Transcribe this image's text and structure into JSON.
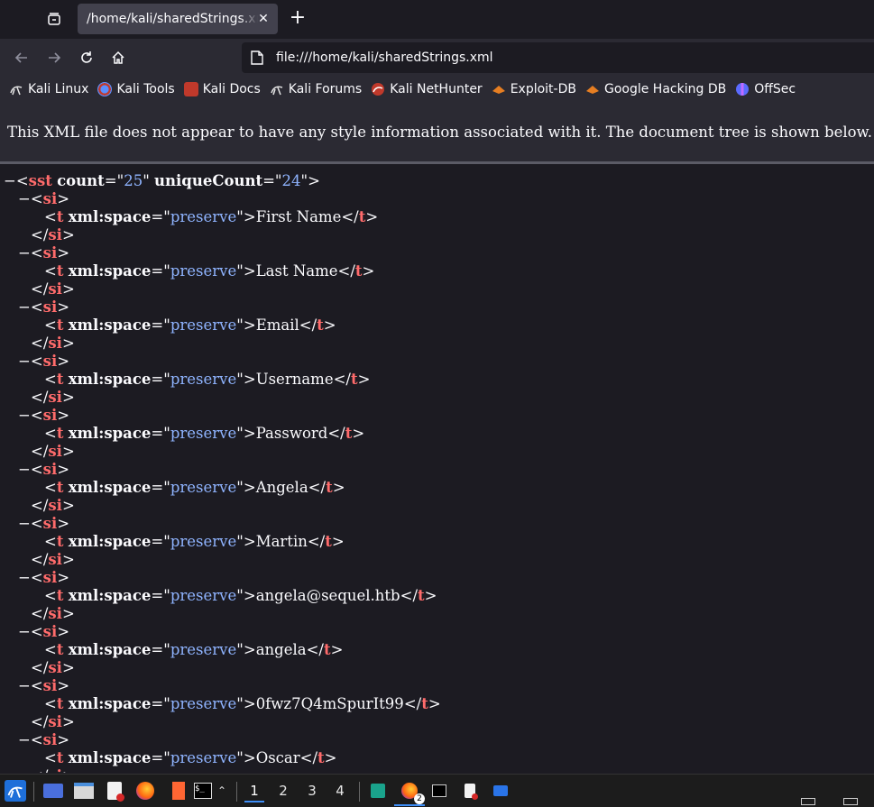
{
  "tabs": [
    {
      "title": "/home/kali/sharedStrings.xml"
    }
  ],
  "url": "file:///home/kali/sharedStrings.xml",
  "bookmarks": [
    {
      "label": "Kali Linux",
      "icon": "kali-dragon-icon"
    },
    {
      "label": "Kali Tools",
      "icon": "kali-tools-icon"
    },
    {
      "label": "Kali Docs",
      "icon": "kali-docs-icon"
    },
    {
      "label": "Kali Forums",
      "icon": "kali-dragon-icon"
    },
    {
      "label": "Kali NetHunter",
      "icon": "nethunter-icon"
    },
    {
      "label": "Exploit-DB",
      "icon": "exploit-db-icon"
    },
    {
      "label": "Google Hacking DB",
      "icon": "ghdb-icon"
    },
    {
      "label": "OffSec",
      "icon": "offsec-icon"
    }
  ],
  "info_message": "This XML file does not appear to have any style information associated with it. The document tree is shown below.",
  "xml": {
    "root_tag": "sst",
    "root_attrs": [
      {
        "name": "count",
        "value": "25"
      },
      {
        "name": "uniqueCount",
        "value": "24"
      }
    ],
    "item_tag": "si",
    "text_tag": "t",
    "text_attr": {
      "name": "xml:space",
      "value": "preserve"
    },
    "strings": [
      "First Name",
      "Last Name",
      "Email",
      "Username",
      "Password",
      "Angela",
      "Martin",
      "angela@sequel.htb",
      "angela",
      "0fwz7Q4mSpurIt99",
      "Oscar"
    ]
  },
  "taskbar": {
    "workspaces": [
      "1",
      "2",
      "3",
      "4"
    ],
    "active_workspace": "1",
    "firefox_badge": "2"
  }
}
